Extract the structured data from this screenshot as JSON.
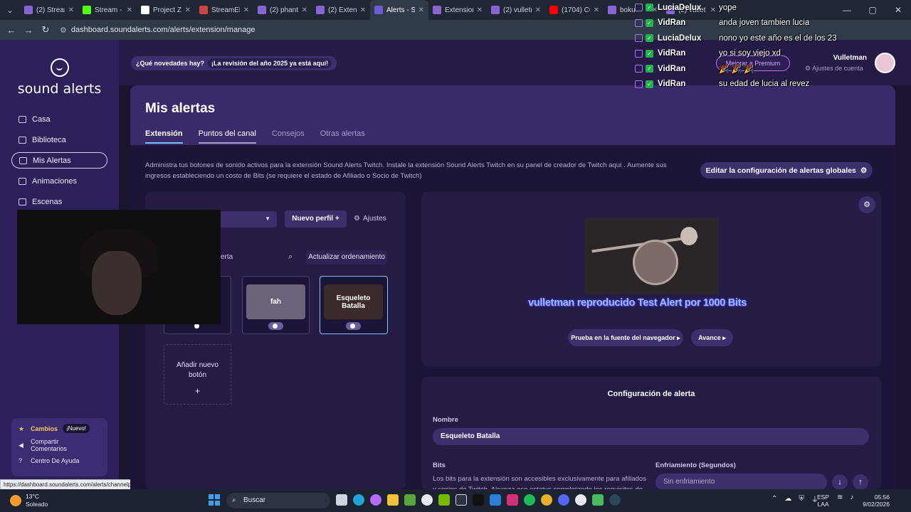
{
  "browser": {
    "tabs": [
      {
        "label": "(2) Stream",
        "color": "#8a63d2"
      },
      {
        "label": "Stream - K",
        "color": "#53fc18"
      },
      {
        "label": "Project Z",
        "color": "#ffffff"
      },
      {
        "label": "StreamEl",
        "color": "#c44"
      },
      {
        "label": "(2) phant",
        "color": "#8a63d2"
      },
      {
        "label": "(2) Exten",
        "color": "#8a63d2"
      },
      {
        "label": "Alerts - S",
        "color": "#6e5bd6",
        "active": true
      },
      {
        "label": "Extension",
        "color": "#8a63d2"
      },
      {
        "label": "(2) vulletr",
        "color": "#8a63d2"
      },
      {
        "label": "(1704) CO",
        "color": "#ff0000"
      },
      {
        "label": "boku",
        "color": "#8a63d2"
      },
      {
        "label": "(2) vullet",
        "color": "#8a63d2"
      }
    ],
    "url": "dashboard.soundalerts.com/alerts/extension/manage",
    "status_url": "https://dashboard.soundalerts.com/alerts/channelpoints"
  },
  "sidebar": {
    "brand": "sound alerts",
    "items": [
      {
        "label": "Casa"
      },
      {
        "label": "Biblioteca"
      },
      {
        "label": "Mis Alertas",
        "active": true
      },
      {
        "label": "Animaciones"
      },
      {
        "label": "Escenas"
      }
    ],
    "help": {
      "changes": "Cambios",
      "new_badge": "¡Nuevo!",
      "share": "Compartir Comentarios",
      "help_center": "Centro De Ayuda"
    }
  },
  "topbar": {
    "news_q": "¿Qué novedades hay?",
    "news_a": "¡La revisión del año 2025 ya está aquí!",
    "premium": "Mejorar a Premium",
    "username": "Vulletman",
    "account_settings": "Ajustes de cuenta"
  },
  "page": {
    "title": "Mis alertas",
    "tabs": [
      "Extensión",
      "Puntos del canal",
      "Consejos",
      "Otras alertas"
    ],
    "description": "Administra tus botones de sonido activos para la extensión Sound Alerts Twitch. Instale la extensión Sound Alerts Twitch en su panel de creador de Twitch aquí . Aumente sus ingresos estableciendo un costo de Bits (se requiere el estado de Afiliado o Socio de Twitch)",
    "global_settings": "Editar la configuración de alertas globales"
  },
  "left": {
    "new_profile": "Nuevo perfil",
    "settings": "Ajustes",
    "search_fragment": "erta",
    "update_order": "Actualizar ordenamiento",
    "cards": [
      {
        "label": "fah",
        "color": "#6a637a"
      },
      {
        "label": "Esqueleto Batalla",
        "color": "#3b2b2b"
      }
    ],
    "add_new": "Añadir nuevo botón",
    "add_plus": "+"
  },
  "preview": {
    "alert_text": "vulletman reproducido Test Alert por 1000 Bits",
    "test_button": "Prueba en la fuente del navegador",
    "advance_button": "Avance"
  },
  "config": {
    "title": "Configuración de alerta",
    "name_label": "Nombre",
    "name_value": "Esqueleto Batalla",
    "bits_label": "Bits",
    "bits_desc": "Los bits para la extensión son accesibles exclusivamente para afiliados y socios de Twitch. Alcanza ese estatus completando los requisitos de",
    "cooldown_label": "Enfriamiento (Segundos)",
    "cooldown_placeholder": "Sin enfriamiento"
  },
  "chat": [
    {
      "user": "LuciaDelux",
      "msg": "yope"
    },
    {
      "user": "VidRan",
      "msg": "anda joven tambien lucia"
    },
    {
      "user": "LuciaDelux",
      "msg": "nono yo este año es el de los 23"
    },
    {
      "user": "VidRan",
      "msg": "yo si soy viejo xd"
    },
    {
      "user": "VidRan",
      "msg": "🎉 🎉 🎉"
    },
    {
      "user": "VidRan",
      "msg": "su edad de lucia al revez"
    }
  ],
  "taskbar": {
    "temp": "13°C",
    "weather": "Soleado",
    "search": "Buscar",
    "lang1": "ESP",
    "lang2": "LAA",
    "time": "05:56",
    "date": "9/02/2026"
  }
}
